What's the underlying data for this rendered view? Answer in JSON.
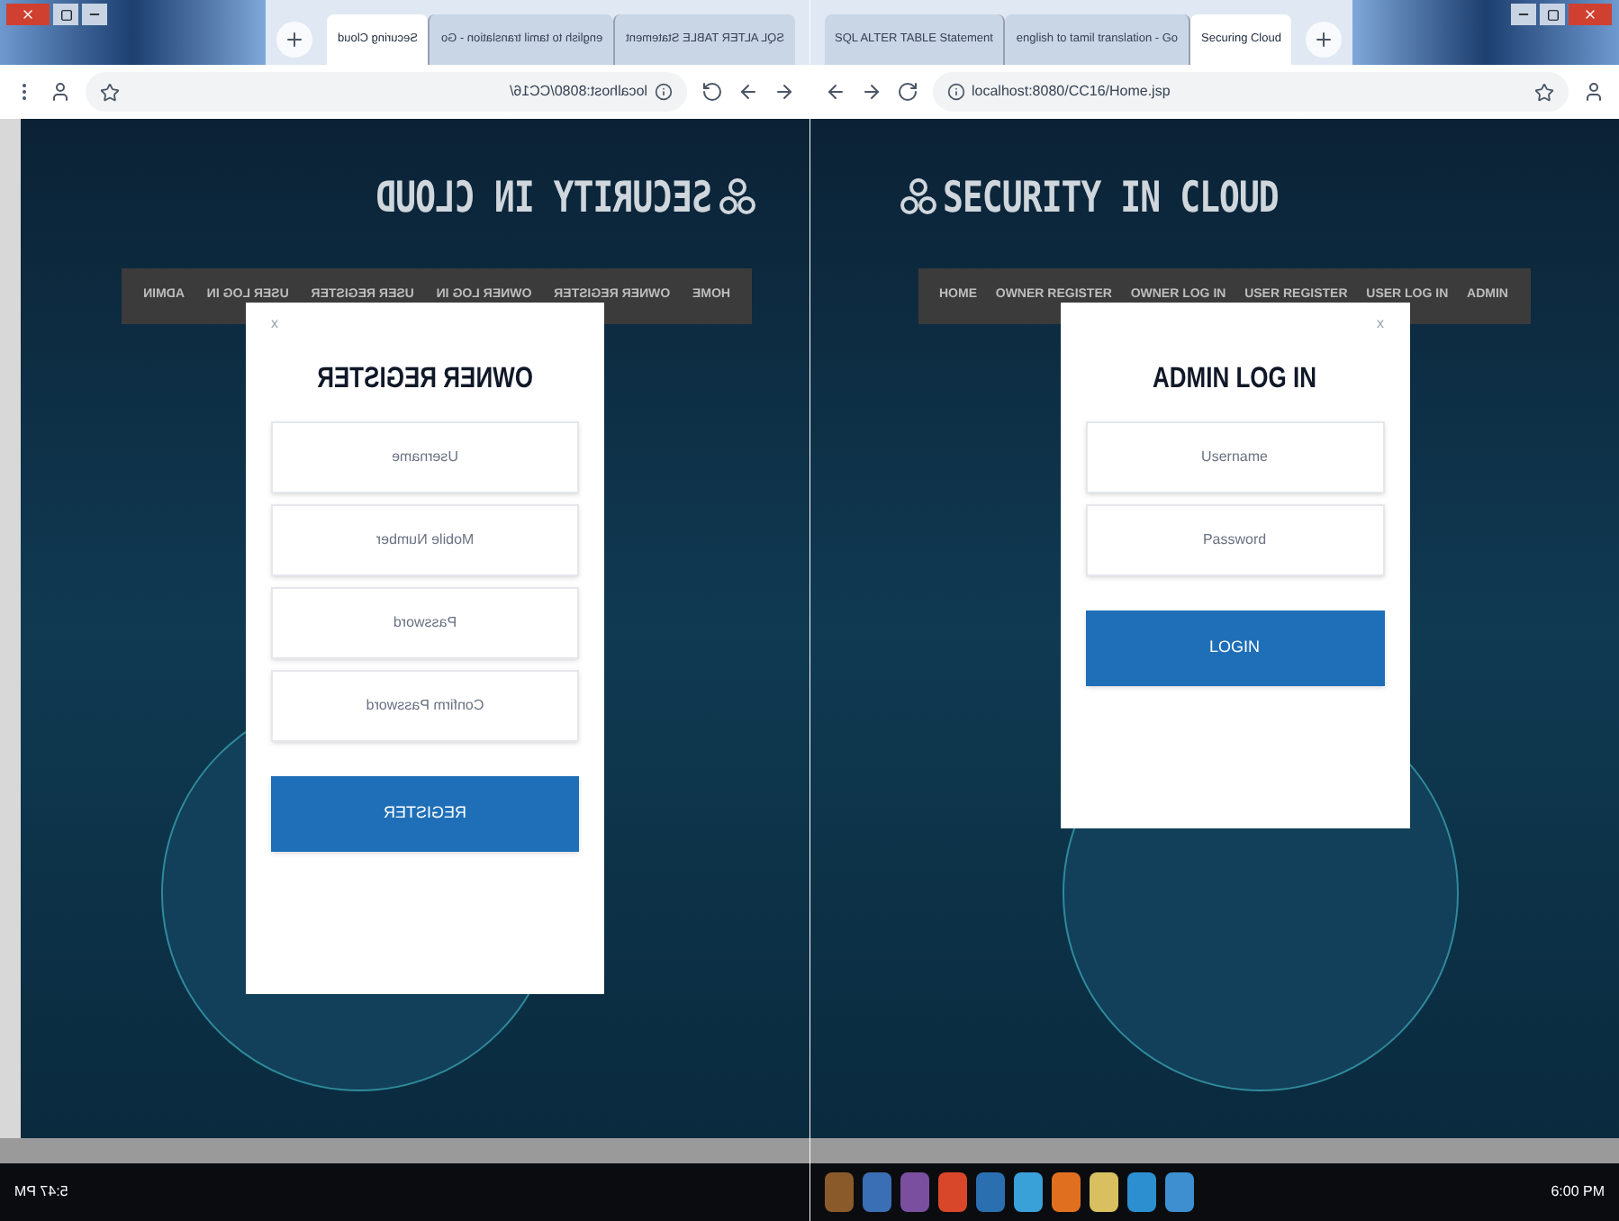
{
  "windows": [
    {
      "mirrored": true,
      "tabs": [
        {
          "title": "Securing Cloud",
          "selected": true
        },
        {
          "title": "english to tamil translation - Go",
          "selected": false
        },
        {
          "title": "SQL ALTER TABLE Statement",
          "selected": false
        }
      ],
      "address": "localhost:8080/CC16/",
      "logo": "SECURITY IN CLOUD",
      "nav": [
        "ADMIN",
        "USER LOG IN",
        "USER REGISTER",
        "OWNER LOG IN",
        "OWNER REGISTER",
        "HOME"
      ],
      "modal": {
        "close": "x",
        "title": "OWNER REGISTER",
        "fields": [
          {
            "placeholder": "Username"
          },
          {
            "placeholder": "Mobile Number"
          },
          {
            "placeholder": "Password"
          },
          {
            "placeholder": "Confirm Password"
          }
        ],
        "button": "REGISTER"
      },
      "clock": "5:47 PM"
    },
    {
      "mirrored": false,
      "tabs": [
        {
          "title": "SQL ALTER TABLE Statement",
          "selected": false
        },
        {
          "title": "english to tamil translation - Go",
          "selected": false
        },
        {
          "title": "Securing Cloud",
          "selected": true
        }
      ],
      "address": "localhost:8080/CC16/Home.jsp",
      "logo": "SECURITY IN CLOUD",
      "nav": [
        "HOME",
        "OWNER REGISTER",
        "OWNER LOG IN",
        "USER REGISTER",
        "USER LOG IN",
        "ADMIN"
      ],
      "modal": {
        "close": "x",
        "title": "ADMIN LOG IN",
        "fields": [
          {
            "placeholder": "Username"
          },
          {
            "placeholder": "Password"
          }
        ],
        "button": "LOGIN"
      },
      "clock": "6:00 PM"
    }
  ]
}
